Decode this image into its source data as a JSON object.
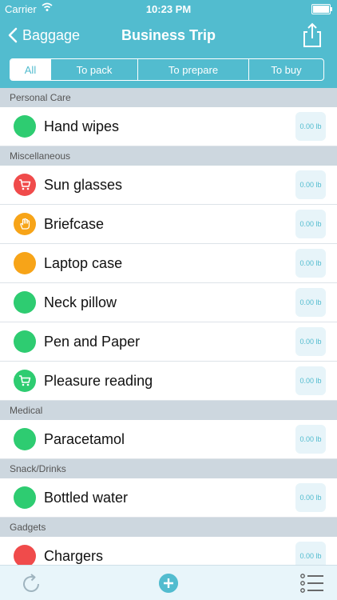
{
  "status_bar": {
    "carrier": "Carrier",
    "time": "10:23 PM"
  },
  "nav": {
    "back_label": "Baggage",
    "title": "Business Trip"
  },
  "tabs": [
    {
      "label": "All",
      "selected": true
    },
    {
      "label": "To pack"
    },
    {
      "label": "To prepare"
    },
    {
      "label": "To buy"
    }
  ],
  "sections": [
    {
      "title": "Personal Care",
      "items": [
        {
          "label": "Hand wipes",
          "weight": "0.00 lb",
          "status_color": "#2ecc71",
          "icon": "none"
        }
      ]
    },
    {
      "title": "Miscellaneous",
      "items": [
        {
          "label": "Sun glasses",
          "weight": "0.00 lb",
          "status_color": "#f04b4b",
          "icon": "cart-icon"
        },
        {
          "label": "Briefcase",
          "weight": "0.00 lb",
          "status_color": "#f7a418",
          "icon": "hand-icon"
        },
        {
          "label": "Laptop case",
          "weight": "0.00 lb",
          "status_color": "#f7a418",
          "icon": "none"
        },
        {
          "label": "Neck pillow",
          "weight": "0.00 lb",
          "status_color": "#2ecc71",
          "icon": "none"
        },
        {
          "label": "Pen and Paper",
          "weight": "0.00 lb",
          "status_color": "#2ecc71",
          "icon": "none"
        },
        {
          "label": "Pleasure reading",
          "weight": "0.00 lb",
          "status_color": "#2ecc71",
          "icon": "cart-icon"
        }
      ]
    },
    {
      "title": "Medical",
      "items": [
        {
          "label": "Paracetamol",
          "weight": "0.00 lb",
          "status_color": "#2ecc71",
          "icon": "none"
        }
      ]
    },
    {
      "title": "Snack/Drinks",
      "items": [
        {
          "label": "Bottled water",
          "weight": "0.00 lb",
          "status_color": "#2ecc71",
          "icon": "none"
        }
      ]
    },
    {
      "title": "Gadgets",
      "items": [
        {
          "label": "Chargers",
          "weight": "0.00 lb",
          "status_color": "#f04b4b",
          "icon": "none"
        }
      ]
    }
  ],
  "colors": {
    "accent": "#52bccf",
    "green": "#2ecc71",
    "red": "#f04b4b",
    "orange": "#f7a418"
  }
}
